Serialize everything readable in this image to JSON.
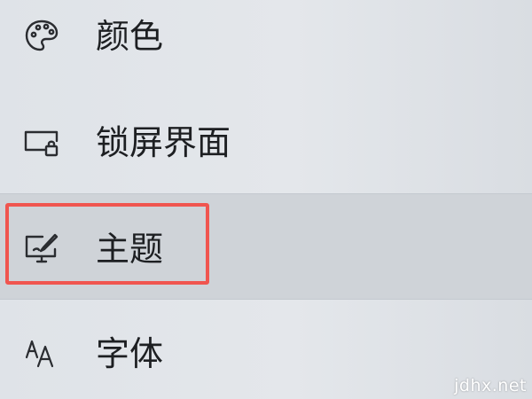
{
  "nav": {
    "items": [
      {
        "label": "颜色",
        "icon": "palette-icon"
      },
      {
        "label": "锁屏界面",
        "icon": "lock-screen-icon"
      },
      {
        "label": "主题",
        "icon": "theme-brush-icon",
        "selected": true
      },
      {
        "label": "字体",
        "icon": "font-icon"
      }
    ]
  },
  "highlight": {
    "color": "#f0554f",
    "target": "主题"
  },
  "watermark": {
    "text": "jdhx.net"
  }
}
